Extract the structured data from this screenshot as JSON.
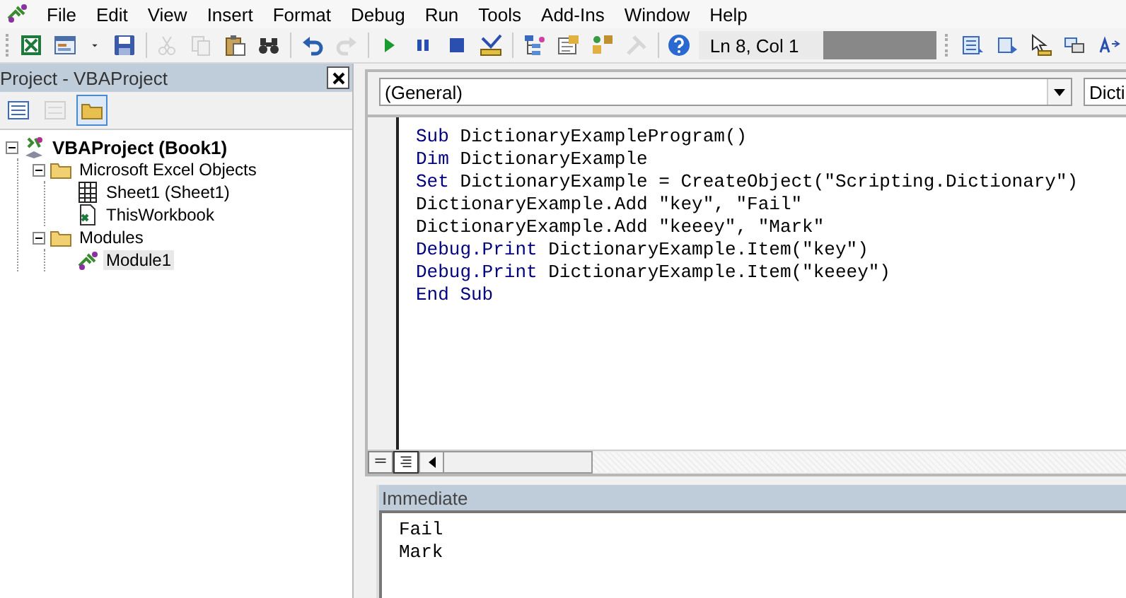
{
  "menu": [
    "File",
    "Edit",
    "View",
    "Insert",
    "Format",
    "Debug",
    "Run",
    "Tools",
    "Add-Ins",
    "Window",
    "Help"
  ],
  "toolbar": [
    {
      "kind": "excel",
      "disabled": false
    },
    {
      "kind": "form",
      "disabled": false
    },
    {
      "kind": "dropdown",
      "disabled": false
    },
    {
      "kind": "save",
      "disabled": false
    },
    {
      "kind": "separator"
    },
    {
      "kind": "cut",
      "disabled": true
    },
    {
      "kind": "copy",
      "disabled": true
    },
    {
      "kind": "paste",
      "disabled": false
    },
    {
      "kind": "find",
      "disabled": false
    },
    {
      "kind": "separator"
    },
    {
      "kind": "undo",
      "disabled": false
    },
    {
      "kind": "redo",
      "disabled": true
    },
    {
      "kind": "separator"
    },
    {
      "kind": "run",
      "disabled": false
    },
    {
      "kind": "break",
      "disabled": false
    },
    {
      "kind": "reset",
      "disabled": false
    },
    {
      "kind": "design",
      "disabled": false
    },
    {
      "kind": "separator"
    },
    {
      "kind": "explorer",
      "disabled": false
    },
    {
      "kind": "properties",
      "disabled": false
    },
    {
      "kind": "browser",
      "disabled": false
    },
    {
      "kind": "toolbox",
      "disabled": true
    },
    {
      "kind": "separator"
    },
    {
      "kind": "help",
      "disabled": false
    }
  ],
  "position": "Ln 8, Col 1",
  "edit_toolbar": [
    {
      "kind": "list"
    },
    {
      "kind": "constants"
    },
    {
      "kind": "quickinfo"
    },
    {
      "kind": "params"
    },
    {
      "kind": "complete"
    }
  ],
  "project": {
    "title": "Project - VBAProject",
    "tools": [
      {
        "kind": "view-code",
        "disabled": false,
        "selected": false
      },
      {
        "kind": "view-object",
        "disabled": true,
        "selected": false
      },
      {
        "kind": "folders",
        "disabled": false,
        "selected": true
      }
    ],
    "tree": [
      {
        "label": "VBAProject (Book1)",
        "kind": "project",
        "expanded": true,
        "selected": false,
        "children": [
          {
            "label": "Microsoft Excel Objects",
            "kind": "folder",
            "expanded": true,
            "selected": false,
            "children": [
              {
                "label": "Sheet1 (Sheet1)",
                "kind": "sheet",
                "selected": false
              },
              {
                "label": "ThisWorkbook",
                "kind": "workbook",
                "selected": false
              }
            ]
          },
          {
            "label": "Modules",
            "kind": "folder",
            "expanded": true,
            "selected": false,
            "children": [
              {
                "label": "Module1",
                "kind": "module",
                "selected": true
              }
            ]
          }
        ]
      }
    ]
  },
  "code": {
    "object_combo": "(General)",
    "procedure_combo": "Dicti",
    "lines": [
      [
        {
          "kind": "keyword",
          "text": "Sub"
        },
        {
          "kind": "plain",
          "text": " DictionaryExampleProgram()"
        }
      ],
      [
        {
          "kind": "keyword",
          "text": "Dim"
        },
        {
          "kind": "plain",
          "text": " DictionaryExample"
        }
      ],
      [
        {
          "kind": "keyword",
          "text": "Set"
        },
        {
          "kind": "plain",
          "text": " DictionaryExample = CreateObject(\"Scripting.Dictionary\")"
        }
      ],
      [
        {
          "kind": "plain",
          "text": "DictionaryExample.Add \"key\", \"Fail\""
        }
      ],
      [
        {
          "kind": "plain",
          "text": "DictionaryExample.Add \"keeey\", \"Mark\""
        }
      ],
      [
        {
          "kind": "keyword",
          "text": "Debug.Print"
        },
        {
          "kind": "plain",
          "text": " DictionaryExample.Item(\"key\")"
        }
      ],
      [
        {
          "kind": "keyword",
          "text": "Debug.Print"
        },
        {
          "kind": "plain",
          "text": " DictionaryExample.Item(\"keeey\")"
        }
      ],
      [
        {
          "kind": "keyword",
          "text": "End Sub"
        }
      ]
    ],
    "views": [
      {
        "kind": "procedure",
        "selected": false
      },
      {
        "kind": "module",
        "selected": true
      }
    ]
  },
  "immediate": {
    "title": "Immediate",
    "lines": [
      "Fail",
      "Mark"
    ]
  }
}
